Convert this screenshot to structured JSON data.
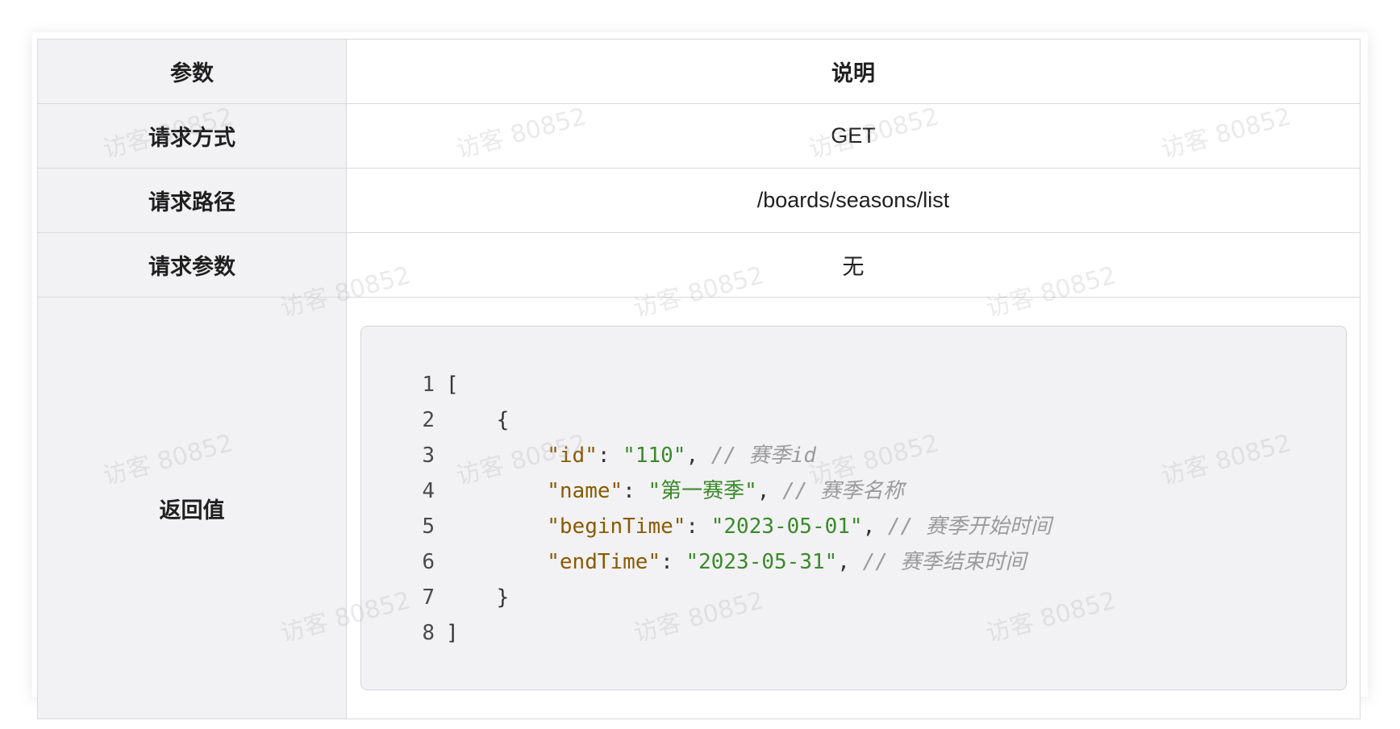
{
  "table": {
    "header": {
      "key": "参数",
      "value": "说明"
    },
    "rows": [
      {
        "key": "请求方式",
        "value": "GET"
      },
      {
        "key": "请求路径",
        "value": "/boards/seasons/list"
      },
      {
        "key": "请求参数",
        "value": "无"
      }
    ],
    "return_label": "返回值"
  },
  "code": {
    "lines": [
      {
        "n": "1",
        "tokens": [
          {
            "t": "punc",
            "v": "["
          }
        ]
      },
      {
        "n": "2",
        "tokens": [
          {
            "t": "punc",
            "v": "    {"
          }
        ]
      },
      {
        "n": "3",
        "tokens": [
          {
            "t": "punc",
            "v": "        "
          },
          {
            "t": "key",
            "v": "\"id\""
          },
          {
            "t": "punc",
            "v": ": "
          },
          {
            "t": "str",
            "v": "\"110\""
          },
          {
            "t": "punc",
            "v": ", "
          },
          {
            "t": "com",
            "v": "// 赛季id"
          }
        ]
      },
      {
        "n": "4",
        "tokens": [
          {
            "t": "punc",
            "v": "        "
          },
          {
            "t": "key",
            "v": "\"name\""
          },
          {
            "t": "punc",
            "v": ": "
          },
          {
            "t": "str",
            "v": "\"第一赛季\""
          },
          {
            "t": "punc",
            "v": ", "
          },
          {
            "t": "com",
            "v": "// 赛季名称"
          }
        ]
      },
      {
        "n": "5",
        "tokens": [
          {
            "t": "punc",
            "v": "        "
          },
          {
            "t": "key",
            "v": "\"beginTime\""
          },
          {
            "t": "punc",
            "v": ": "
          },
          {
            "t": "str",
            "v": "\"2023-05-01\""
          },
          {
            "t": "punc",
            "v": ", "
          },
          {
            "t": "com",
            "v": "// 赛季开始时间"
          }
        ]
      },
      {
        "n": "6",
        "tokens": [
          {
            "t": "punc",
            "v": "        "
          },
          {
            "t": "key",
            "v": "\"endTime\""
          },
          {
            "t": "punc",
            "v": ": "
          },
          {
            "t": "str",
            "v": "\"2023-05-31\""
          },
          {
            "t": "punc",
            "v": ", "
          },
          {
            "t": "com",
            "v": "// 赛季结束时间"
          }
        ]
      },
      {
        "n": "7",
        "tokens": [
          {
            "t": "punc",
            "v": "    }"
          }
        ]
      },
      {
        "n": "8",
        "tokens": [
          {
            "t": "punc",
            "v": "]"
          }
        ]
      }
    ]
  },
  "watermark": {
    "text": "访客 80852"
  },
  "colors": {
    "key": "#8a5a00",
    "string": "#3a8a2a",
    "comment": "#9a9a9a",
    "header_bg": "#f2f2f4",
    "border": "#d9d9d9"
  }
}
